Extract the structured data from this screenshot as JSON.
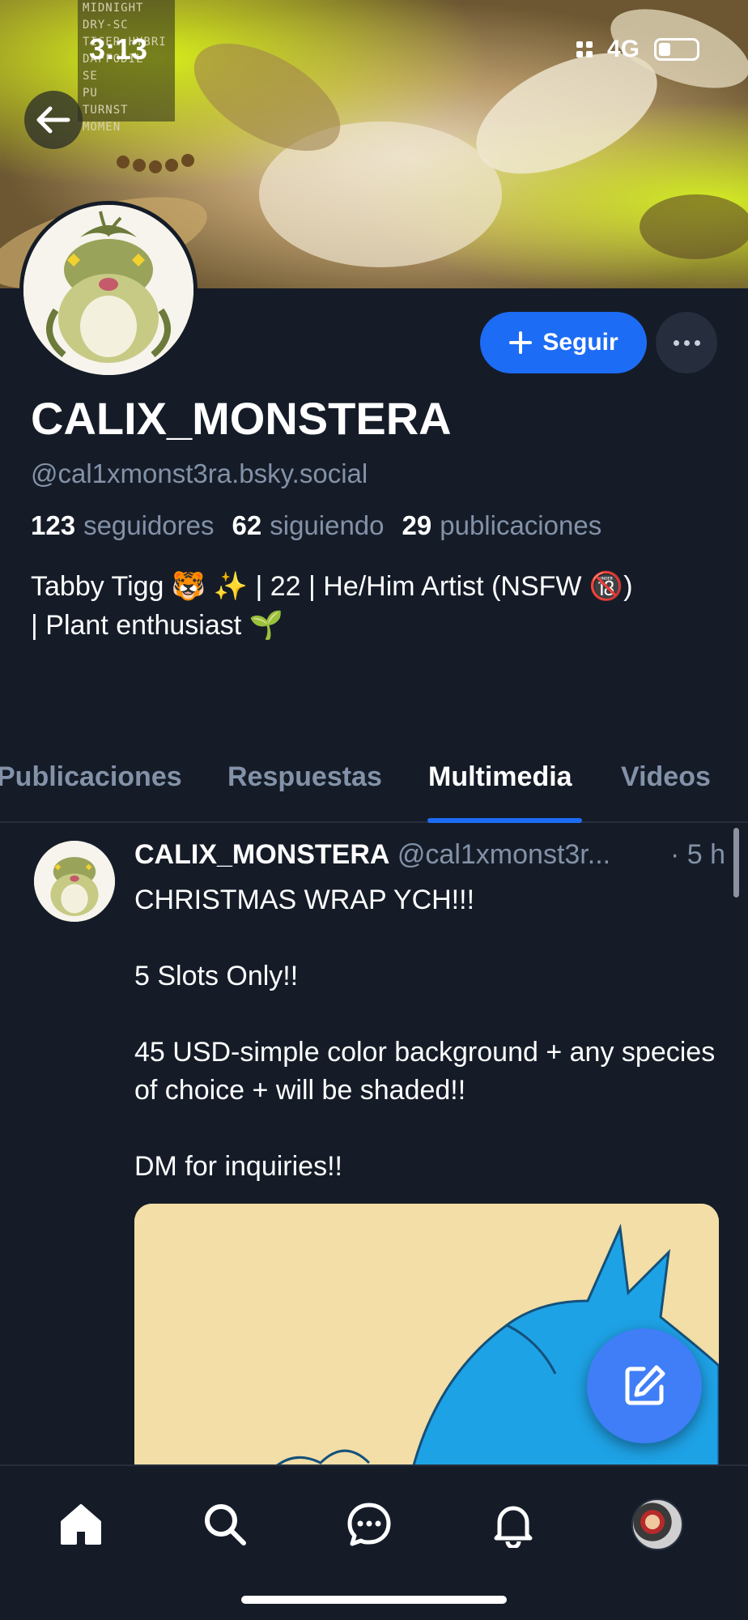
{
  "status_bar": {
    "time": "3:13",
    "network": "4G",
    "battery_level": 0.25
  },
  "banner": {
    "overlay_text": [
      "MIDNIGHT DRY-SC",
      "TIGER HYBRI",
      "DAFFODIL",
      "SE",
      "PU",
      "TURNST",
      "MOMEN"
    ]
  },
  "profile": {
    "display_name": "CALIX_MONSTERA",
    "handle": "@cal1xmonst3ra.bsky.social",
    "followers_count": "123",
    "followers_label": "seguidores",
    "following_count": "62",
    "following_label": "siguiendo",
    "posts_count": "29",
    "posts_label": "publicaciones",
    "bio_line1": "Tabby Tigg 🐯 ✨ | 22 | He/Him Artist (NSFW 🔞)",
    "bio_line2": "| Plant enthusiast 🌱"
  },
  "actions": {
    "follow_label": "Seguir"
  },
  "tabs": [
    {
      "label": "Publicaciones",
      "active": false
    },
    {
      "label": "Respuestas",
      "active": false
    },
    {
      "label": "Multimedia",
      "active": true
    },
    {
      "label": "Videos",
      "active": false
    }
  ],
  "post": {
    "author_name": "CALIX_MONSTERA",
    "author_handle": "@cal1xmonst3r...",
    "time": "· 5 h",
    "lines": [
      "CHRISTMAS WRAP YCH!!!",
      "",
      "5 Slots Only!!",
      "",
      "45 USD-simple color background + any species of choice + will be shaded!!",
      "",
      "DM for inquiries!!"
    ]
  },
  "bottom_nav": [
    {
      "icon": "home-icon",
      "active": true
    },
    {
      "icon": "search-icon",
      "active": false
    },
    {
      "icon": "chat-icon",
      "active": false
    },
    {
      "icon": "bell-icon",
      "active": false
    },
    {
      "icon": "profile-avatar",
      "active": false
    }
  ],
  "colors": {
    "background": "#151c28",
    "accent": "#1d6cf5",
    "muted_text": "#8392a8",
    "fab": "#3f7ef6"
  }
}
